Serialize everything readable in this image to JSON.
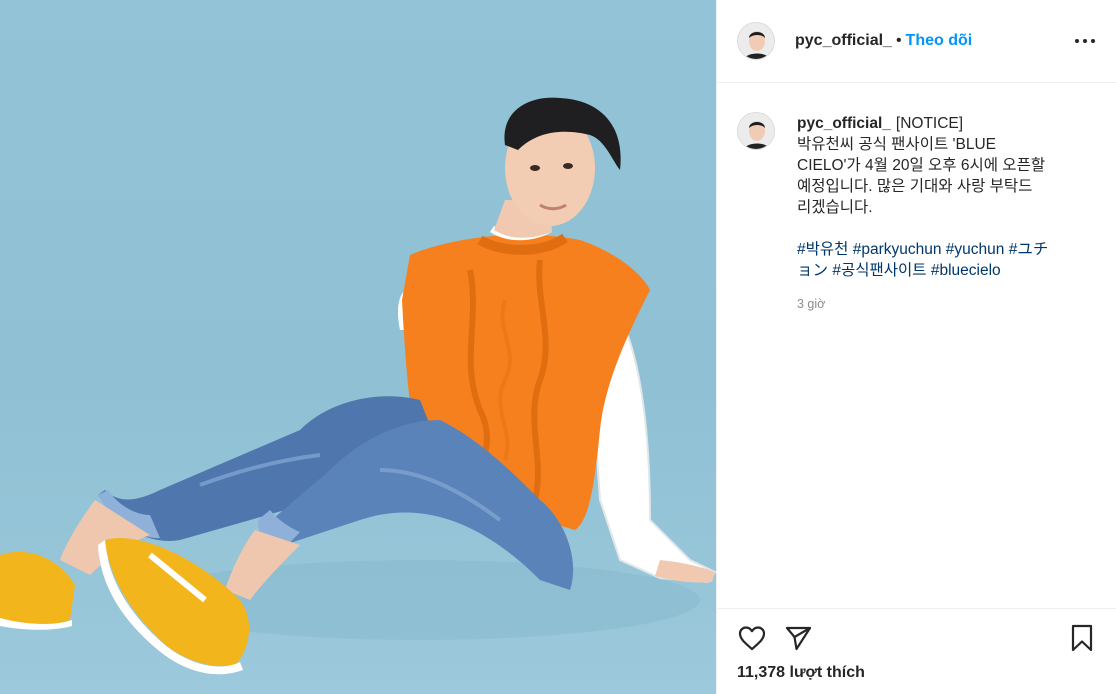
{
  "post": {
    "username": "pyc_official_",
    "separator": "•",
    "follow_label": "Theo dõi",
    "more_icon": "more-options-icon",
    "caption_lines": [
      "[NOTICE]",
      "박유천씨 공식 팬사이트 'BLUE",
      "CIELO'가 4월 20일 오후 6시에 오픈할",
      "예정입니다. 많은 기대와 사랑 부탁드",
      "리겠습니다."
    ],
    "hashtags_line1": [
      "#박유천",
      "#parkyuchun",
      "#yuchun",
      "#ユチ"
    ],
    "hashtags_line2": [
      "ョン",
      "#공식팬사이트",
      "#bluecielo"
    ],
    "time_ago": "3 giờ",
    "likes_text": "11,378 lượt thích"
  },
  "icons": {
    "like": "heart-icon",
    "share": "send-icon",
    "save": "bookmark-icon"
  },
  "colors": {
    "accent": "#0095f6",
    "hashtag": "#00376b",
    "photo_background": "#8fc0d4"
  }
}
